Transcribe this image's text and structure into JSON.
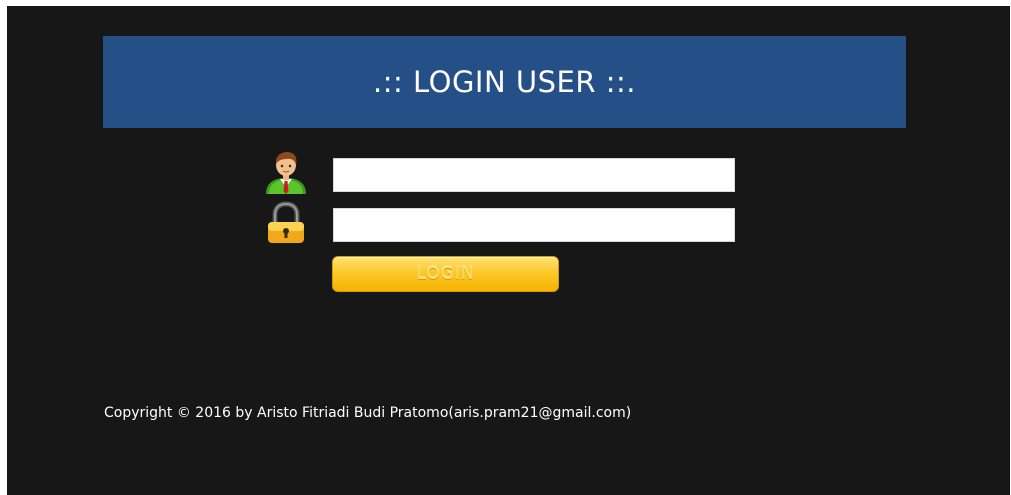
{
  "header": {
    "title": ".:: LOGIN USER ::."
  },
  "form": {
    "username_icon": "user-icon",
    "password_icon": "lock-icon",
    "username_value": "",
    "password_value": "",
    "login_label": "LOGIN"
  },
  "footer": {
    "copyright": "Copyright © 2016 by Aristo Fitriadi Budi Pratomo(aris.pram21@gmail.com)"
  },
  "colors": {
    "background": "#171717",
    "header": "#244f87",
    "button": "#fcc92a"
  }
}
